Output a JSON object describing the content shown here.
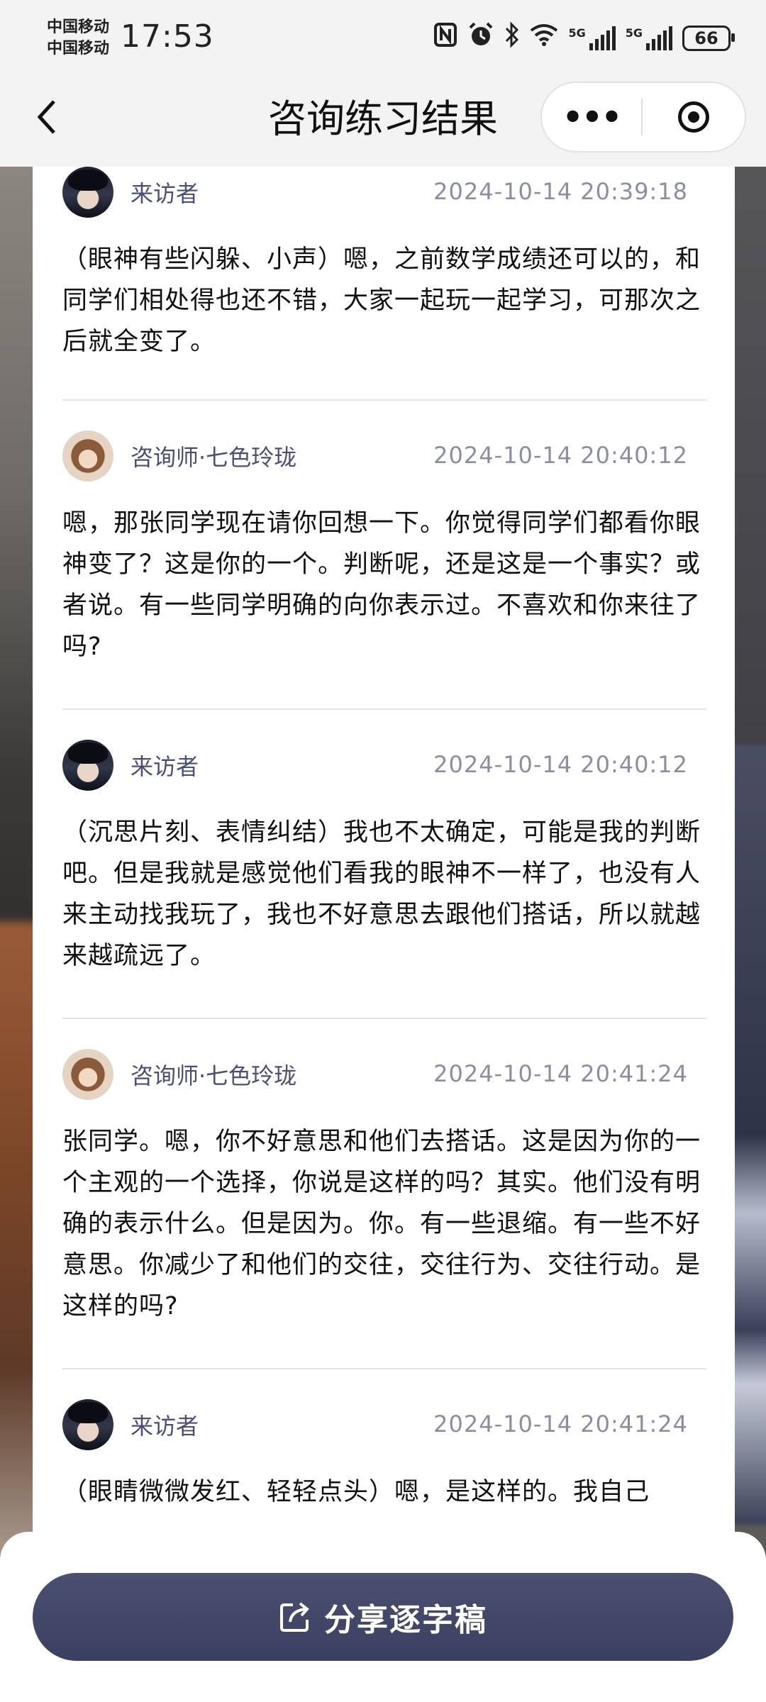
{
  "status_bar": {
    "carrier_1": "中国移动",
    "carrier_2": "中国移动",
    "time": "17:53",
    "signal_1_label": "5G",
    "signal_2_label": "5G",
    "battery": "66",
    "icons": [
      "nfc-icon",
      "alarm-icon",
      "bluetooth-icon",
      "wifi-icon",
      "signal-icon",
      "signal-icon",
      "battery-icon"
    ]
  },
  "nav": {
    "back_icon": "chevron-left-icon",
    "title": "咨询练习结果",
    "more_icon": "more-dots-icon",
    "close_icon": "target-close-icon"
  },
  "messages": [
    {
      "role": "visitor",
      "name": "来访者",
      "time": "2024-10-14 20:39:18",
      "text": "（眼神有些闪躲、小声）嗯，之前数学成绩还可以的，和同学们相处得也还不错，大家一起玩一起学习，可那次之后就全变了。"
    },
    {
      "role": "counselor",
      "name": "咨询师·七色玲珑",
      "time": "2024-10-14 20:40:12",
      "text": "嗯，那张同学现在请你回想一下。你觉得同学们都看你眼神变了？这是你的一个。判断呢，还是这是一个事实？或者说。有一些同学明确的向你表示过。不喜欢和你来往了吗?"
    },
    {
      "role": "visitor",
      "name": "来访者",
      "time": "2024-10-14 20:40:12",
      "text": "（沉思片刻、表情纠结）我也不太确定，可能是我的判断吧。但是我就是感觉他们看我的眼神不一样了，也没有人来主动找我玩了，我也不好意思去跟他们搭话，所以就越来越疏远了。"
    },
    {
      "role": "counselor",
      "name": "咨询师·七色玲珑",
      "time": "2024-10-14 20:41:24",
      "text": "张同学。嗯，你不好意思和他们去搭话。这是因为你的一个主观的一个选择，你说是这样的吗？其实。他们没有明确的表示什么。但是因为。你。有一些退缩。有一些不好意思。你减少了和他们的交往，交往行为、交往行动。是这样的吗?"
    },
    {
      "role": "visitor",
      "name": "来访者",
      "time": "2024-10-14 20:41:24",
      "text": "（眼睛微微发红、轻轻点头）嗯，是这样的。我自己"
    }
  ],
  "bottom": {
    "share_icon": "share-icon",
    "share_label": "分享逐字稿"
  }
}
